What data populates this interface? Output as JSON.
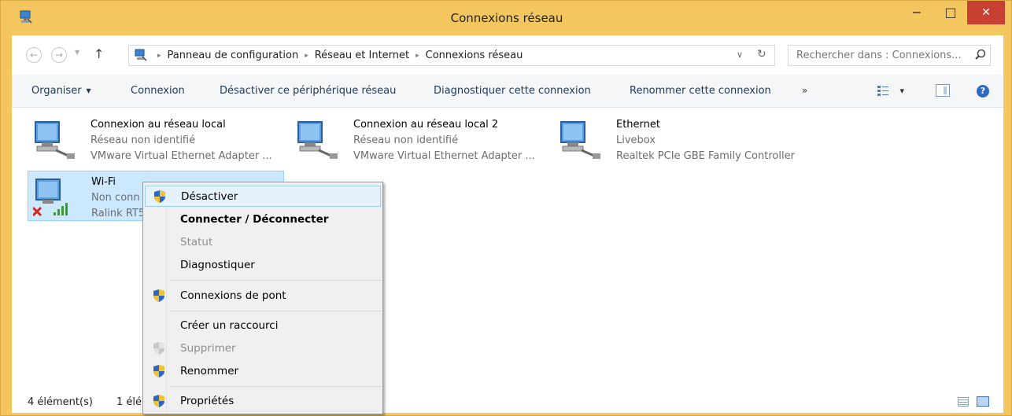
{
  "window": {
    "title": "Connexions réseau",
    "minimize": "−",
    "maximize": "□",
    "close": "✕"
  },
  "nav": {
    "back": "←",
    "forward": "→",
    "dropdown": "▼",
    "up": "↑"
  },
  "address": {
    "crumbs": [
      "Panneau de configuration",
      "Réseau et Internet",
      "Connexions réseau"
    ],
    "separator": "▸",
    "dropdown": "∨",
    "refresh": "↻"
  },
  "search": {
    "placeholder": "Rechercher dans : Connexions..."
  },
  "toolbar": {
    "organise": "Organiser",
    "organise_drop": "▼",
    "connexion": "Connexion",
    "disable": "Désactiver ce périphérique réseau",
    "diagnose": "Diagnostiquer cette connexion",
    "rename": "Renommer cette connexion",
    "more": "»",
    "views_drop": "▾",
    "help": "?"
  },
  "connections": [
    {
      "name": "Connexion au réseau local",
      "status": "Réseau non identifié",
      "adapter": "VMware Virtual Ethernet Adapter ..."
    },
    {
      "name": "Connexion au réseau local 2",
      "status": "Réseau non identifié",
      "adapter": "VMware Virtual Ethernet Adapter ..."
    },
    {
      "name": "Ethernet",
      "status": "Livebox",
      "adapter": "Realtek PCIe GBE Family Controller"
    },
    {
      "name": "Wi-Fi",
      "status": "Non conn",
      "adapter": "Ralink RT5"
    }
  ],
  "context_menu": {
    "items": [
      {
        "label": "Désactiver",
        "icon": "uac-shield-icon"
      },
      {
        "label": "Connecter / Déconnecter"
      },
      {
        "label": "Statut"
      },
      {
        "label": "Diagnostiquer"
      },
      {
        "label": "Connexions de pont",
        "icon": "uac-shield-icon"
      },
      {
        "label": "Créer un raccourci"
      },
      {
        "label": "Supprimer",
        "icon": "uac-shield-icon"
      },
      {
        "label": "Renommer",
        "icon": "uac-shield-icon"
      },
      {
        "label": "Propriétés",
        "icon": "uac-shield-icon"
      }
    ]
  },
  "statusbar": {
    "count": "4 élément(s)",
    "selected": "1 élé"
  },
  "colors": {
    "titlebar": "#f3c660",
    "close_button": "#c84031",
    "selection": "#cce8ff",
    "link_text": "#1e395b"
  }
}
